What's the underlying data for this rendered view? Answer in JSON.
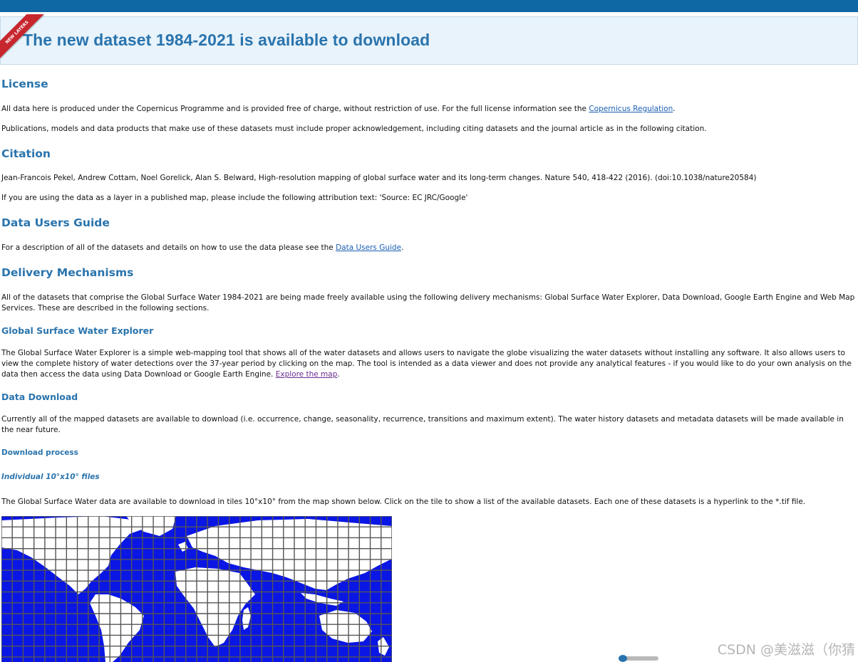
{
  "banner": {
    "title": "The new dataset 1984-2021 is available to download",
    "ribbon_label": "NEW LAYERS"
  },
  "license": {
    "heading": "License",
    "p1_text": "All data here is produced under the Copernicus Programme and is provided free of charge, without restriction of use. For the full license information see the ",
    "p1_link": "Copernicus Regulation",
    "p1_end": ".",
    "p2": "Publications, models and data products that make use of these datasets must include proper acknowledgement, including citing datasets and the journal article as in the following citation."
  },
  "citation": {
    "heading": "Citation",
    "p1": "Jean-Francois Pekel, Andrew Cottam, Noel Gorelick, Alan S. Belward, High-resolution mapping of global surface water and its long-term changes. Nature 540, 418-422 (2016). (doi:10.1038/nature20584)",
    "p2": "If you are using the data as a layer in a published map, please include the following attribution text: 'Source: EC JRC/Google'"
  },
  "users_guide": {
    "heading": "Data Users Guide",
    "p1_text": "For a description of all of the datasets and details on how to use the data please see the ",
    "p1_link": "Data Users Guide",
    "p1_end": "."
  },
  "delivery": {
    "heading": "Delivery Mechanisms",
    "p1": "All of the datasets that comprise the Global Surface Water 1984-2021 are being made freely available using the following delivery mechanisms: Global Surface Water Explorer, Data Download, Google Earth Engine and Web Map Services. These are described in the following sections."
  },
  "explorer": {
    "heading": "Global Surface Water Explorer",
    "p1_text": "The Global Surface Water Explorer is a simple web-mapping tool that shows all of the water datasets and allows users to navigate the globe visualizing the water datasets without installing any software. It also allows users to view the complete history of water detections over the 37-year period by clicking on the map. The tool is intended as a data viewer and does not provide any analytical features - if you would like to do your own analysis on the data then access the data using Data Download or Google Earth Engine. ",
    "p1_link": "Explore the map",
    "p1_end": "."
  },
  "download": {
    "heading": "Data Download",
    "p1": "Currently all of the mapped datasets are available to download (i.e. occurrence, change, seasonality, recurrence, transitions and maximum extent). The water history datasets and metadata datasets will be made available in the near future.",
    "process_heading": "Download process",
    "tiles_heading": "Individual 10°x10° files",
    "p2": "The Global Surface Water data are available to download in tiles 10°x10° from the map shown below. Click on the tile to show a list of the available datasets. Each one of these datasets is a hyperlink to the *.tif file."
  },
  "watermark": "CSDN @美滋滋（你猜",
  "colors": {
    "topbar": "#0f67a3",
    "heading": "#2a74ad",
    "link": "#1a5fb4",
    "visited_link": "#6a2c91",
    "map_ocean": "#0a16e4",
    "map_land": "#ffffff",
    "map_grid": "#555555",
    "ribbon": "#c8262e"
  }
}
